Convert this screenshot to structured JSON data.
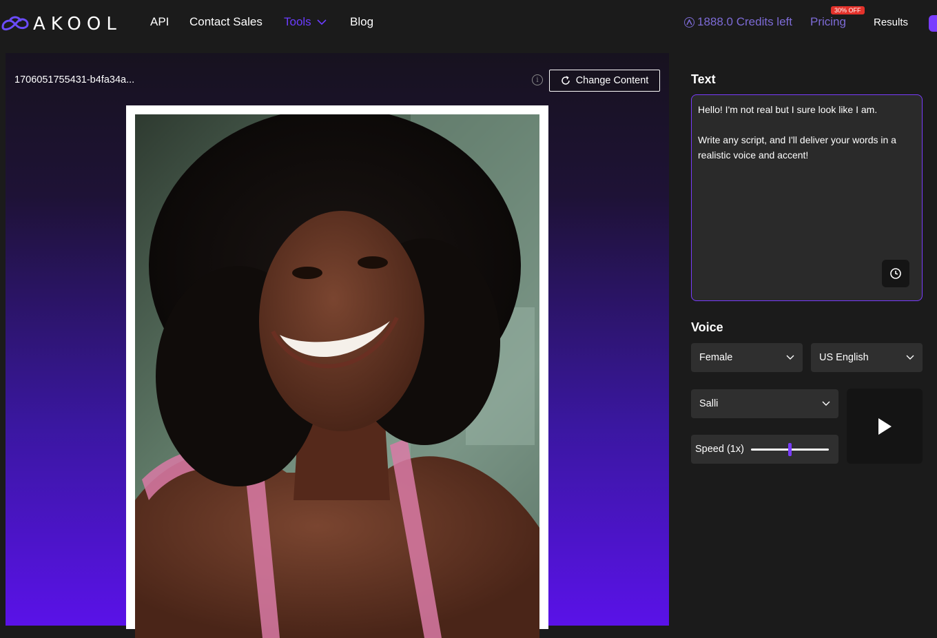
{
  "nav": {
    "logo_text": "AKOOL",
    "items": [
      "API",
      "Contact Sales",
      "Tools",
      "Blog"
    ],
    "credits": "1888.0 Credits left",
    "pricing": "Pricing",
    "pricing_badge": "30% OFF",
    "results": "Results"
  },
  "preview": {
    "file_name": "1706051755431-b4fa34a...",
    "change_button": "Change Content",
    "info_icon": "i"
  },
  "text_section": {
    "title": "Text",
    "paragraph1": "Hello! I'm not real but I sure look like I am.",
    "paragraph2": "Write any script, and I'll deliver your words in a realistic voice and accent!"
  },
  "voice_section": {
    "title": "Voice",
    "gender": "Female",
    "language": "US English",
    "voice_name": "Salli",
    "speed_label": "Speed (1x)",
    "speed_fraction": 0.5
  },
  "colors": {
    "accent": "#7a3cff",
    "credits": "#7d6bd6",
    "badge": "#e3322b"
  }
}
